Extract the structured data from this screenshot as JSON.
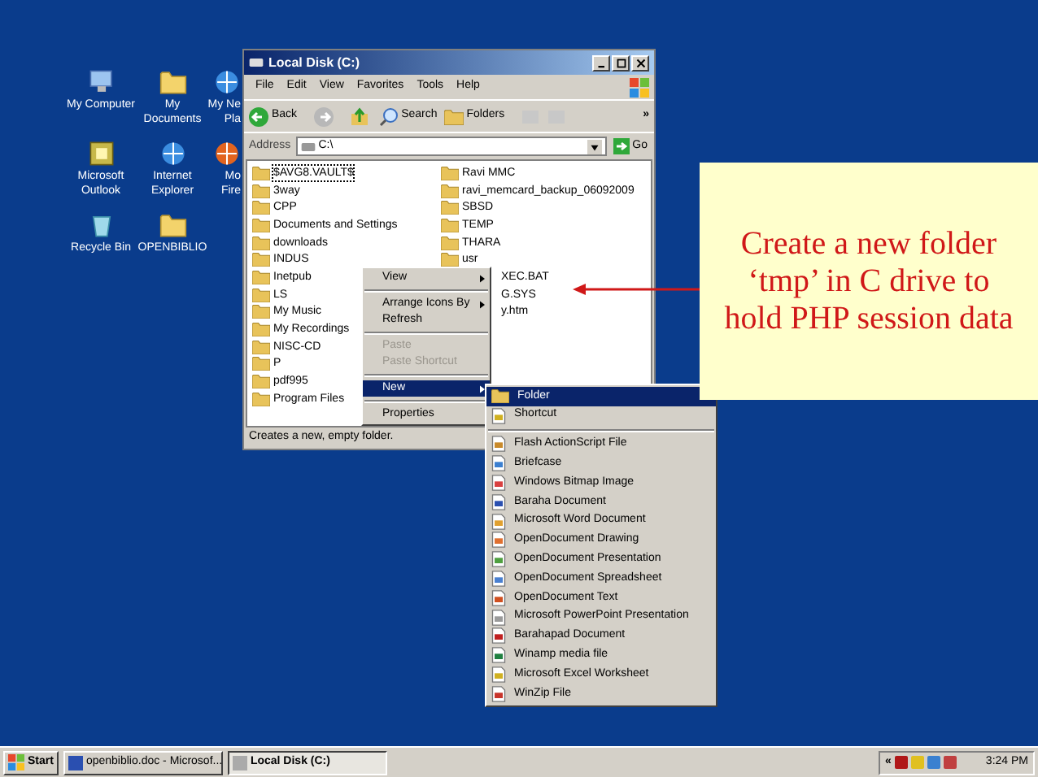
{
  "desktop_icons": [
    {
      "lines": [
        "My Computer"
      ]
    },
    {
      "lines": [
        "My",
        "Documents"
      ]
    },
    {
      "lines": [
        "My Ne",
        "Pla"
      ]
    },
    {
      "lines": [
        "Microsoft",
        "Outlook"
      ]
    },
    {
      "lines": [
        "Internet",
        "Explorer"
      ]
    },
    {
      "lines": [
        "Mo",
        "Fire"
      ]
    },
    {
      "lines": [
        "Recycle Bin"
      ]
    },
    {
      "lines": [
        "OPENBIBLIO"
      ]
    }
  ],
  "window": {
    "title": "Local Disk (C:)",
    "menu": [
      "File",
      "Edit",
      "View",
      "Favorites",
      "Tools",
      "Help"
    ],
    "toolbar": {
      "back": "Back",
      "search": "Search",
      "folders": "Folders",
      "more": "»"
    },
    "address": {
      "label": "Address",
      "value": "C:\\",
      "go": "Go"
    },
    "files_column_1": [
      {
        "name": "$AVG8.VAULT$",
        "focused": true
      },
      {
        "name": "3way",
        "focused": false
      },
      {
        "name": "CPP",
        "focused": false
      },
      {
        "name": "Documents and Settings",
        "focused": false
      },
      {
        "name": "downloads",
        "focused": false
      },
      {
        "name": "INDUS",
        "focused": false
      },
      {
        "name": "Inetpub",
        "focused": false
      },
      {
        "name": "LS",
        "focused": false
      },
      {
        "name": "My Music",
        "focused": false
      },
      {
        "name": "My Recordings",
        "focused": false
      },
      {
        "name": "NISC-CD",
        "focused": false
      },
      {
        "name": "P",
        "focused": false
      },
      {
        "name": "pdf995",
        "focused": false
      },
      {
        "name": "Program Files",
        "focused": false
      }
    ],
    "files_column_2": [
      {
        "name": "Ravi MMC",
        "kind": "folder"
      },
      {
        "name": "ravi_memcard_backup_06092009",
        "kind": "folder"
      },
      {
        "name": "SBSD",
        "kind": "folder"
      },
      {
        "name": "TEMP",
        "kind": "folder"
      },
      {
        "name": "THARA",
        "kind": "folder"
      },
      {
        "name": "usr",
        "kind": "folder"
      },
      {
        "name": "XEC.BAT",
        "kind": "file"
      },
      {
        "name": "G.SYS",
        "kind": "file"
      },
      {
        "name": "y.htm",
        "kind": "file"
      }
    ],
    "status_bar": "Creates a new, empty folder."
  },
  "context_menu": [
    {
      "kind": "item",
      "label": "View",
      "submenu": true,
      "disabled": false,
      "selected": false
    },
    {
      "kind": "separator"
    },
    {
      "kind": "item",
      "label": "Arrange Icons By",
      "submenu": true,
      "disabled": false,
      "selected": false
    },
    {
      "kind": "item",
      "label": "Refresh",
      "submenu": false,
      "disabled": false,
      "selected": false
    },
    {
      "kind": "separator"
    },
    {
      "kind": "item",
      "label": "Paste",
      "submenu": false,
      "disabled": true,
      "selected": false
    },
    {
      "kind": "item",
      "label": "Paste Shortcut",
      "submenu": false,
      "disabled": true,
      "selected": false
    },
    {
      "kind": "separator"
    },
    {
      "kind": "item",
      "label": "New",
      "submenu": true,
      "disabled": false,
      "selected": true
    },
    {
      "kind": "separator"
    },
    {
      "kind": "item",
      "label": "Properties",
      "submenu": false,
      "disabled": false,
      "selected": false
    }
  ],
  "new_submenu": [
    {
      "kind": "item",
      "label": "Folder",
      "selected": true
    },
    {
      "kind": "item",
      "label": "Shortcut",
      "selected": false
    },
    {
      "kind": "separator"
    },
    {
      "kind": "item",
      "label": "Flash ActionScript File",
      "selected": false
    },
    {
      "kind": "item",
      "label": "Briefcase",
      "selected": false
    },
    {
      "kind": "item",
      "label": "Windows Bitmap Image",
      "selected": false
    },
    {
      "kind": "item",
      "label": "Baraha Document",
      "selected": false
    },
    {
      "kind": "item",
      "label": "Microsoft Word Document",
      "selected": false
    },
    {
      "kind": "item",
      "label": "OpenDocument Drawing",
      "selected": false
    },
    {
      "kind": "item",
      "label": "OpenDocument Presentation",
      "selected": false
    },
    {
      "kind": "item",
      "label": "OpenDocument Spreadsheet",
      "selected": false
    },
    {
      "kind": "item",
      "label": "OpenDocument Text",
      "selected": false
    },
    {
      "kind": "item",
      "label": "Microsoft PowerPoint Presentation",
      "selected": false
    },
    {
      "kind": "item",
      "label": "Barahapad Document",
      "selected": false
    },
    {
      "kind": "item",
      "label": "Winamp media file",
      "selected": false
    },
    {
      "kind": "item",
      "label": "Microsoft Excel Worksheet",
      "selected": false
    },
    {
      "kind": "item",
      "label": "WinZip File",
      "selected": false
    }
  ],
  "callout": {
    "lines": [
      "Create a new folder",
      "‘tmp’ in C drive to",
      "hold PHP session data"
    ]
  },
  "taskbar": {
    "start": "Start",
    "tasks": [
      {
        "label": "openbiblio.doc - Microsof...",
        "selected": false
      },
      {
        "label": "Local Disk (C:)",
        "selected": true
      }
    ],
    "tray_expand": "«",
    "clock": "3:24 PM"
  }
}
